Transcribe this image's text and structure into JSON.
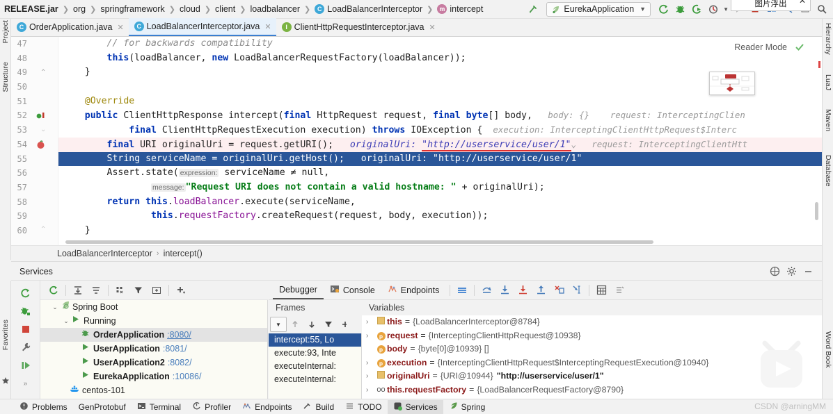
{
  "navbar": {
    "crumbs": [
      {
        "label": "RELEASE.jar",
        "bold": true,
        "icon": ""
      },
      {
        "label": "org",
        "bold": false,
        "icon": ""
      },
      {
        "label": "springframework",
        "bold": false,
        "icon": ""
      },
      {
        "label": "cloud",
        "bold": false,
        "icon": ""
      },
      {
        "label": "client",
        "bold": false,
        "icon": ""
      },
      {
        "label": "loadbalancer",
        "bold": false,
        "icon": ""
      },
      {
        "label": "LoadBalancerInterceptor",
        "bold": false,
        "icon": "class-badge"
      },
      {
        "label": "intercept",
        "bold": false,
        "icon": "method-badge"
      }
    ],
    "run_config": "EurekaApplication",
    "buttons": [
      {
        "name": "build-button",
        "glyph": "build"
      },
      {
        "name": "run-button",
        "glyph": "run"
      },
      {
        "name": "debug-button",
        "glyph": "debug"
      },
      {
        "name": "run-with-coverage-button",
        "glyph": "coverage"
      },
      {
        "name": "profile-button",
        "glyph": "profile"
      },
      {
        "name": "resume-button",
        "glyph": "resume"
      },
      {
        "name": "stop-button",
        "glyph": "stop"
      }
    ]
  },
  "overlay": {
    "title": "图片浮出",
    "close": "✕"
  },
  "tabs": [
    {
      "label": "OrderApplication.java",
      "icon": "java-class-icon",
      "active": false,
      "close": "✕"
    },
    {
      "label": "LoadBalancerInterceptor.java",
      "icon": "java-class-icon",
      "active": true,
      "close": "✕"
    },
    {
      "label": "ClientHttpRequestInterceptor.java",
      "icon": "java-interface-icon",
      "active": false,
      "close": "✕"
    }
  ],
  "left_strip": {
    "items": [
      "Project",
      "Structure",
      "Favorites"
    ]
  },
  "right_strip": {
    "items": [
      "Hierarchy",
      "LuaJ",
      "Maven",
      "Database",
      "Word Book"
    ]
  },
  "editor": {
    "reader_mode": "Reader Mode",
    "lines": [
      {
        "num": "47",
        "state": "normal"
      },
      {
        "num": "48",
        "state": "normal"
      },
      {
        "num": "49",
        "state": "normal"
      },
      {
        "num": "50",
        "state": "normal"
      },
      {
        "num": "51",
        "state": "normal"
      },
      {
        "num": "52",
        "state": "gutter-run"
      },
      {
        "num": "53",
        "state": "normal"
      },
      {
        "num": "54",
        "state": "breakpoint"
      },
      {
        "num": "55",
        "state": "current"
      },
      {
        "num": "56",
        "state": "normal"
      },
      {
        "num": "57",
        "state": "normal"
      },
      {
        "num": "58",
        "state": "normal"
      },
      {
        "num": "59",
        "state": "normal"
      },
      {
        "num": "60",
        "state": "normal"
      }
    ],
    "code": {
      "l47_comment": "// for backwards compatibility",
      "l48": "this(loadBalancer, new LoadBalancerRequestFactory(loadBalancer));",
      "l49": "}",
      "l51_annotation": "@Override",
      "l52": "public ClientHttpResponse intercept(final HttpRequest request, final byte[] body,",
      "l52_hint_body": "body: {}",
      "l52_hint_request": "request: InterceptingClien",
      "l53": "final ClientHttpRequestExecution execution) throws IOException {",
      "l53_hint": "execution: InterceptingClientHttpRequest$Interc",
      "l54": "final URI originalUri = request.getURI();",
      "l54_hint_label": "originalUri:",
      "l54_hint_value": "\"http://userservice/user/1\"",
      "l54_hint_request": "request: InterceptingClientHtt",
      "l55": "String serviceName = originalUri.getHost();",
      "l55_hint_label": "originalUri:",
      "l55_hint_value": "\"http://userservice/user/1\"",
      "l56": "Assert.state(",
      "l56_hintbox": "expression:",
      "l56_rest": " serviceName ≠ null,",
      "l57_hintbox": "message:",
      "l57_str": "\"Request URI does not contain a valid hostname: \"",
      "l57_rest": " + originalUri);",
      "l58": "return this.loadBalancer.execute(serviceName,",
      "l59": "this.requestFactory.createRequest(request, body, execution));",
      "l60": "}"
    },
    "breadcrumb": [
      "LoadBalancerInterceptor",
      "intercept()"
    ]
  },
  "services": {
    "title": "Services",
    "tree_toolbar": [
      {
        "name": "rerun-button"
      },
      {
        "name": "expand-all-button"
      },
      {
        "name": "collapse-all-button"
      },
      {
        "name": "group-button"
      },
      {
        "name": "filter-button"
      },
      {
        "name": "add-tab-button"
      },
      {
        "name": "add-service-button"
      }
    ],
    "gutter_buttons": [
      {
        "name": "rerun-service-icon"
      },
      {
        "name": "debug-service-icon"
      },
      {
        "name": "stop-service-icon"
      },
      {
        "name": "settings-wrench-icon"
      },
      {
        "name": "resume-program-icon"
      },
      {
        "name": "more-icon"
      }
    ],
    "tree": [
      {
        "indent": 0,
        "twisty": "⌄",
        "icon": "spring-boot-icon",
        "label": "Spring Boot",
        "port": "",
        "bold": false,
        "selected": false
      },
      {
        "indent": 1,
        "twisty": "⌄",
        "icon": "run-icon",
        "label": "Running",
        "port": "",
        "bold": false,
        "selected": false
      },
      {
        "indent": 2,
        "twisty": "",
        "icon": "debug-icon",
        "label": "OrderApplication",
        "port": ":8080/",
        "bold": true,
        "selected": true,
        "port_underline": true
      },
      {
        "indent": 2,
        "twisty": "",
        "icon": "run-icon",
        "label": "UserApplication",
        "port": ":8081/",
        "bold": true,
        "selected": false
      },
      {
        "indent": 2,
        "twisty": "",
        "icon": "run-icon",
        "label": "UserApplication2",
        "port": ":8082/",
        "bold": true,
        "selected": false
      },
      {
        "indent": 2,
        "twisty": "",
        "icon": "run-icon",
        "label": "EurekaApplication",
        "port": ":10086/",
        "bold": true,
        "selected": false
      },
      {
        "indent": 1,
        "twisty": "",
        "icon": "docker-icon",
        "label": "centos-101",
        "port": "",
        "bold": false,
        "selected": false
      }
    ]
  },
  "debugger": {
    "tabs": [
      {
        "label": "Debugger",
        "icon": "",
        "active": true
      },
      {
        "label": "Console",
        "icon": "console-icon",
        "active": false
      },
      {
        "label": "Endpoints",
        "icon": "endpoints-icon",
        "active": false
      }
    ],
    "toolbar": [
      {
        "name": "layout-settings-icon"
      },
      {
        "name": "step-over-icon"
      },
      {
        "name": "step-into-icon"
      },
      {
        "name": "force-step-into-icon"
      },
      {
        "name": "step-out-icon"
      },
      {
        "name": "drop-frame-icon"
      },
      {
        "name": "run-to-cursor-icon"
      },
      {
        "name": "evaluate-expression-icon"
      },
      {
        "name": "mute-breakpoints-icon"
      }
    ],
    "frames_header": "Frames",
    "variables_header": "Variables",
    "frames_toolbar": [
      {
        "name": "thread-selector-button"
      },
      {
        "name": "frame-up-button"
      },
      {
        "name": "frame-down-button"
      },
      {
        "name": "filter-frames-button"
      },
      {
        "name": "add-frame-button"
      },
      {
        "name": "remove-frame-button"
      }
    ],
    "frames": [
      {
        "label": "intercept:55, Lo",
        "selected": true
      },
      {
        "label": "execute:93, Inte",
        "selected": false
      },
      {
        "label": "executeInternal:",
        "selected": false
      },
      {
        "label": "executeInternal:",
        "selected": false
      }
    ],
    "variables": [
      {
        "chevron": "›",
        "icon": "field-icon",
        "name": "this",
        "eq": "=",
        "value": "{LoadBalancerInterceptor@8784}",
        "string": ""
      },
      {
        "chevron": "›",
        "icon": "param-icon",
        "name": "request",
        "eq": "=",
        "value": "{InterceptingClientHttpRequest@10938}",
        "string": ""
      },
      {
        "chevron": "",
        "icon": "param-icon",
        "name": "body",
        "eq": "=",
        "value": "{byte[0]@10939} []",
        "string": ""
      },
      {
        "chevron": "›",
        "icon": "param-icon",
        "name": "execution",
        "eq": "=",
        "value": "{InterceptingClientHttpRequest$InterceptingRequestExecution@10940}",
        "string": ""
      },
      {
        "chevron": "›",
        "icon": "field-icon",
        "name": "originalUri",
        "eq": "=",
        "value": "{URI@10944}",
        "string": "\"http://userservice/user/1\""
      },
      {
        "chevron": "›",
        "icon": "watch-icon",
        "name": "this.requestFactory",
        "eq": "=",
        "value": "{LoadBalancerRequestFactory@8790}",
        "string": ""
      }
    ]
  },
  "statusbar": {
    "items": [
      {
        "label": "Problems",
        "icon": "problems-icon",
        "active": false
      },
      {
        "label": "GenProtobuf",
        "icon": "",
        "active": false
      },
      {
        "label": "Terminal",
        "icon": "terminal-icon",
        "active": false
      },
      {
        "label": "Profiler",
        "icon": "profiler-icon",
        "active": false
      },
      {
        "label": "Endpoints",
        "icon": "endpoints-icon",
        "active": false
      },
      {
        "label": "Build",
        "icon": "build-icon",
        "active": false
      },
      {
        "label": "TODO",
        "icon": "todo-icon",
        "active": false
      },
      {
        "label": "Services",
        "icon": "services-icon",
        "active": true
      },
      {
        "label": "Spring",
        "icon": "spring-icon",
        "active": false
      }
    ]
  },
  "watermark": {
    "text": "CSDN @arningMM"
  },
  "colors": {
    "accent_blue": "#2a5699",
    "keyword": "#0033b3",
    "string": "#067d17",
    "field": "#871094",
    "annotation": "#9e880d",
    "breakpoint_line": "#fdeff0",
    "green": "#4c9a4c"
  }
}
